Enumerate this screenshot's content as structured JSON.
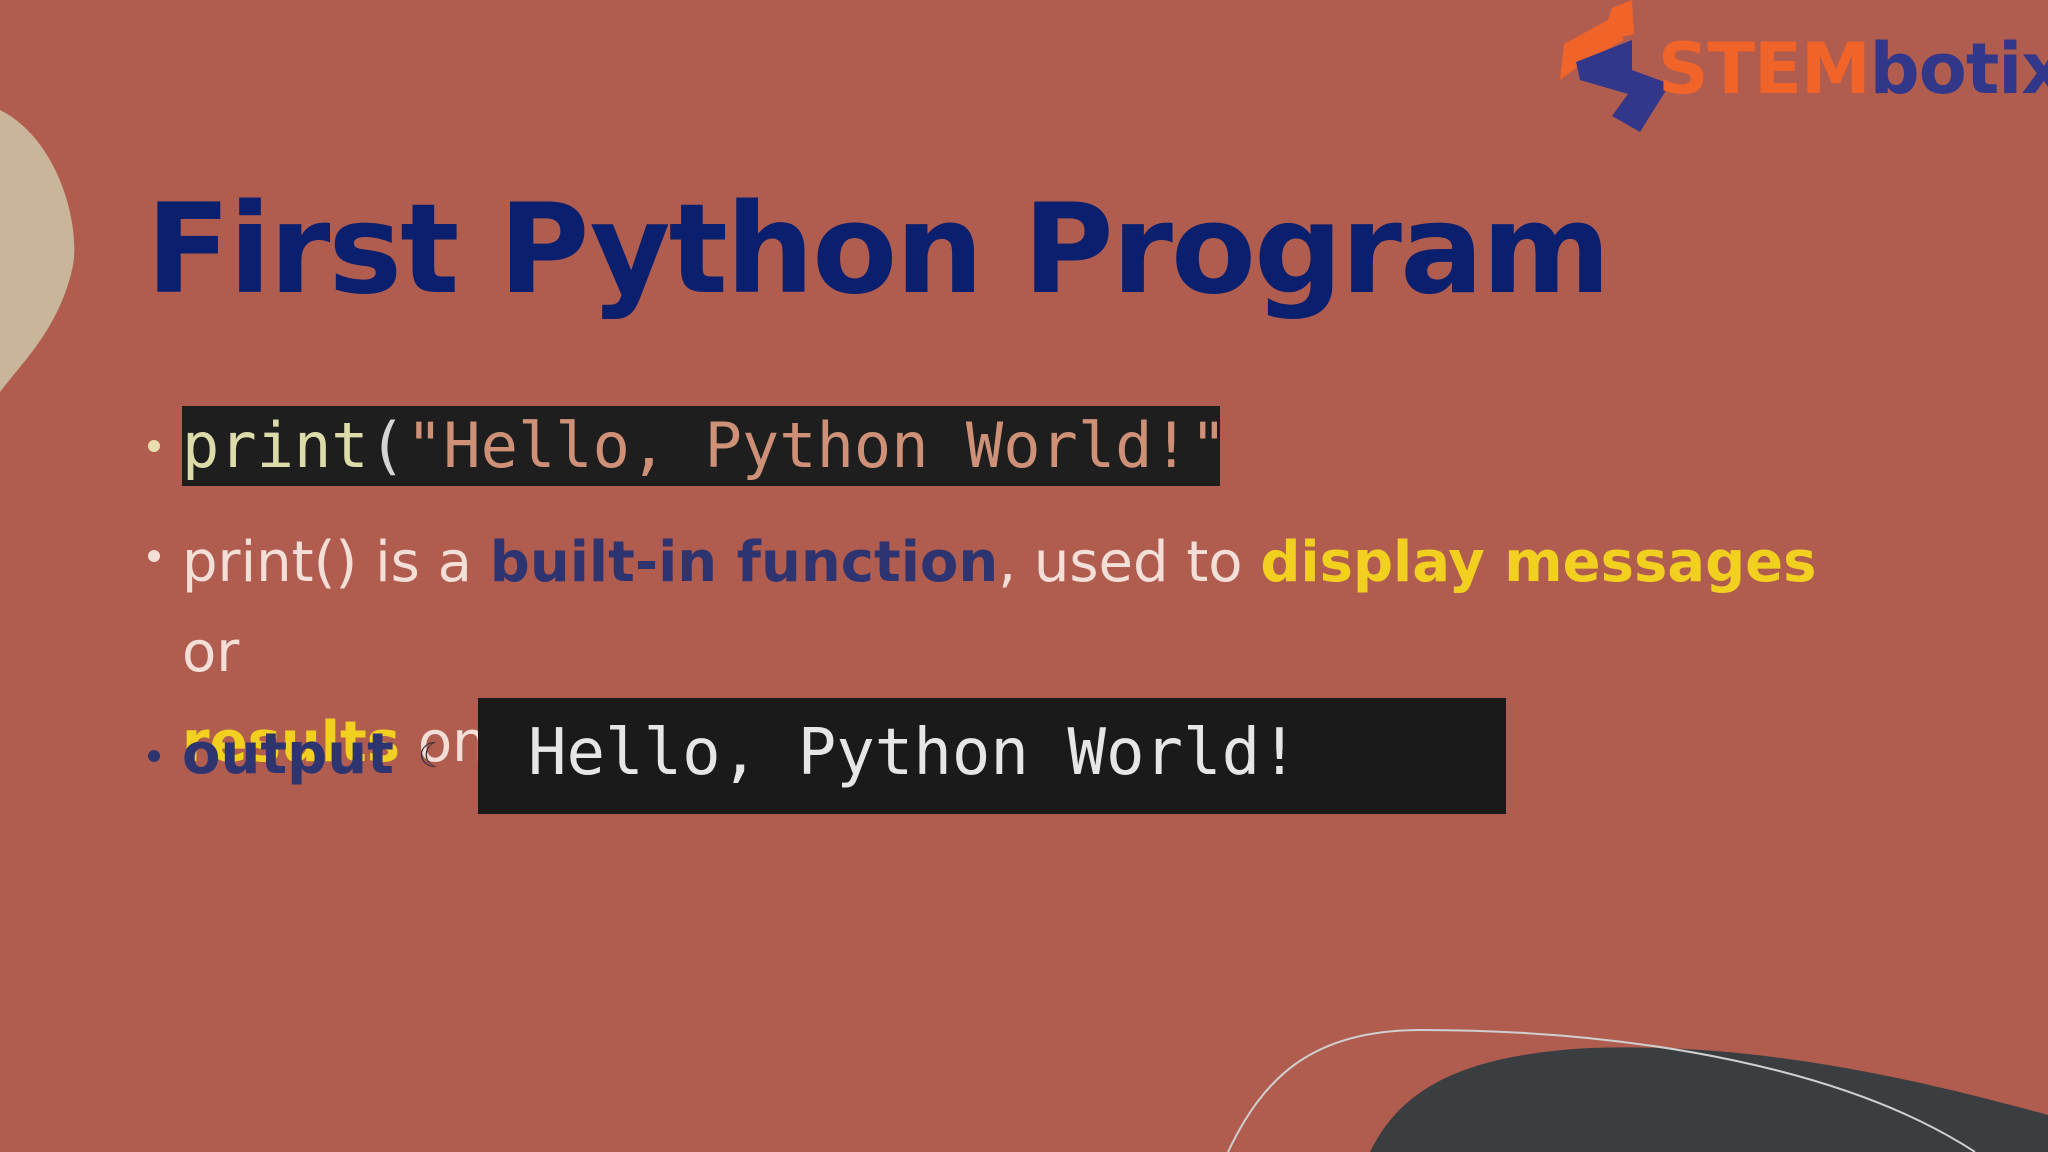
{
  "brand": {
    "part1": "STEM",
    "part2": "botix"
  },
  "slide": {
    "title": "First Python Program",
    "code_line": {
      "fn": "print",
      "open": "(",
      "string": "\"Hello, Python World!\"",
      "close": ")"
    },
    "description": {
      "t1": "print() is a ",
      "h1": "built-in function",
      "t2": ", used to ",
      "h2": "display messages",
      "t3": " or ",
      "h3": "results",
      "t4": " on the console"
    },
    "output_label": "output",
    "output_text": "Hello, Python World!"
  },
  "colors": {
    "background": "#b05d4f",
    "title": "#0a1f6e",
    "highlight_dark": "#2e3470",
    "highlight_yellow": "#f2d020",
    "brand_orange": "#f0642a",
    "brand_navy": "#32378a",
    "code_bg": "#1e1e1e"
  },
  "icons": {
    "output_mark": "moon-icon"
  }
}
